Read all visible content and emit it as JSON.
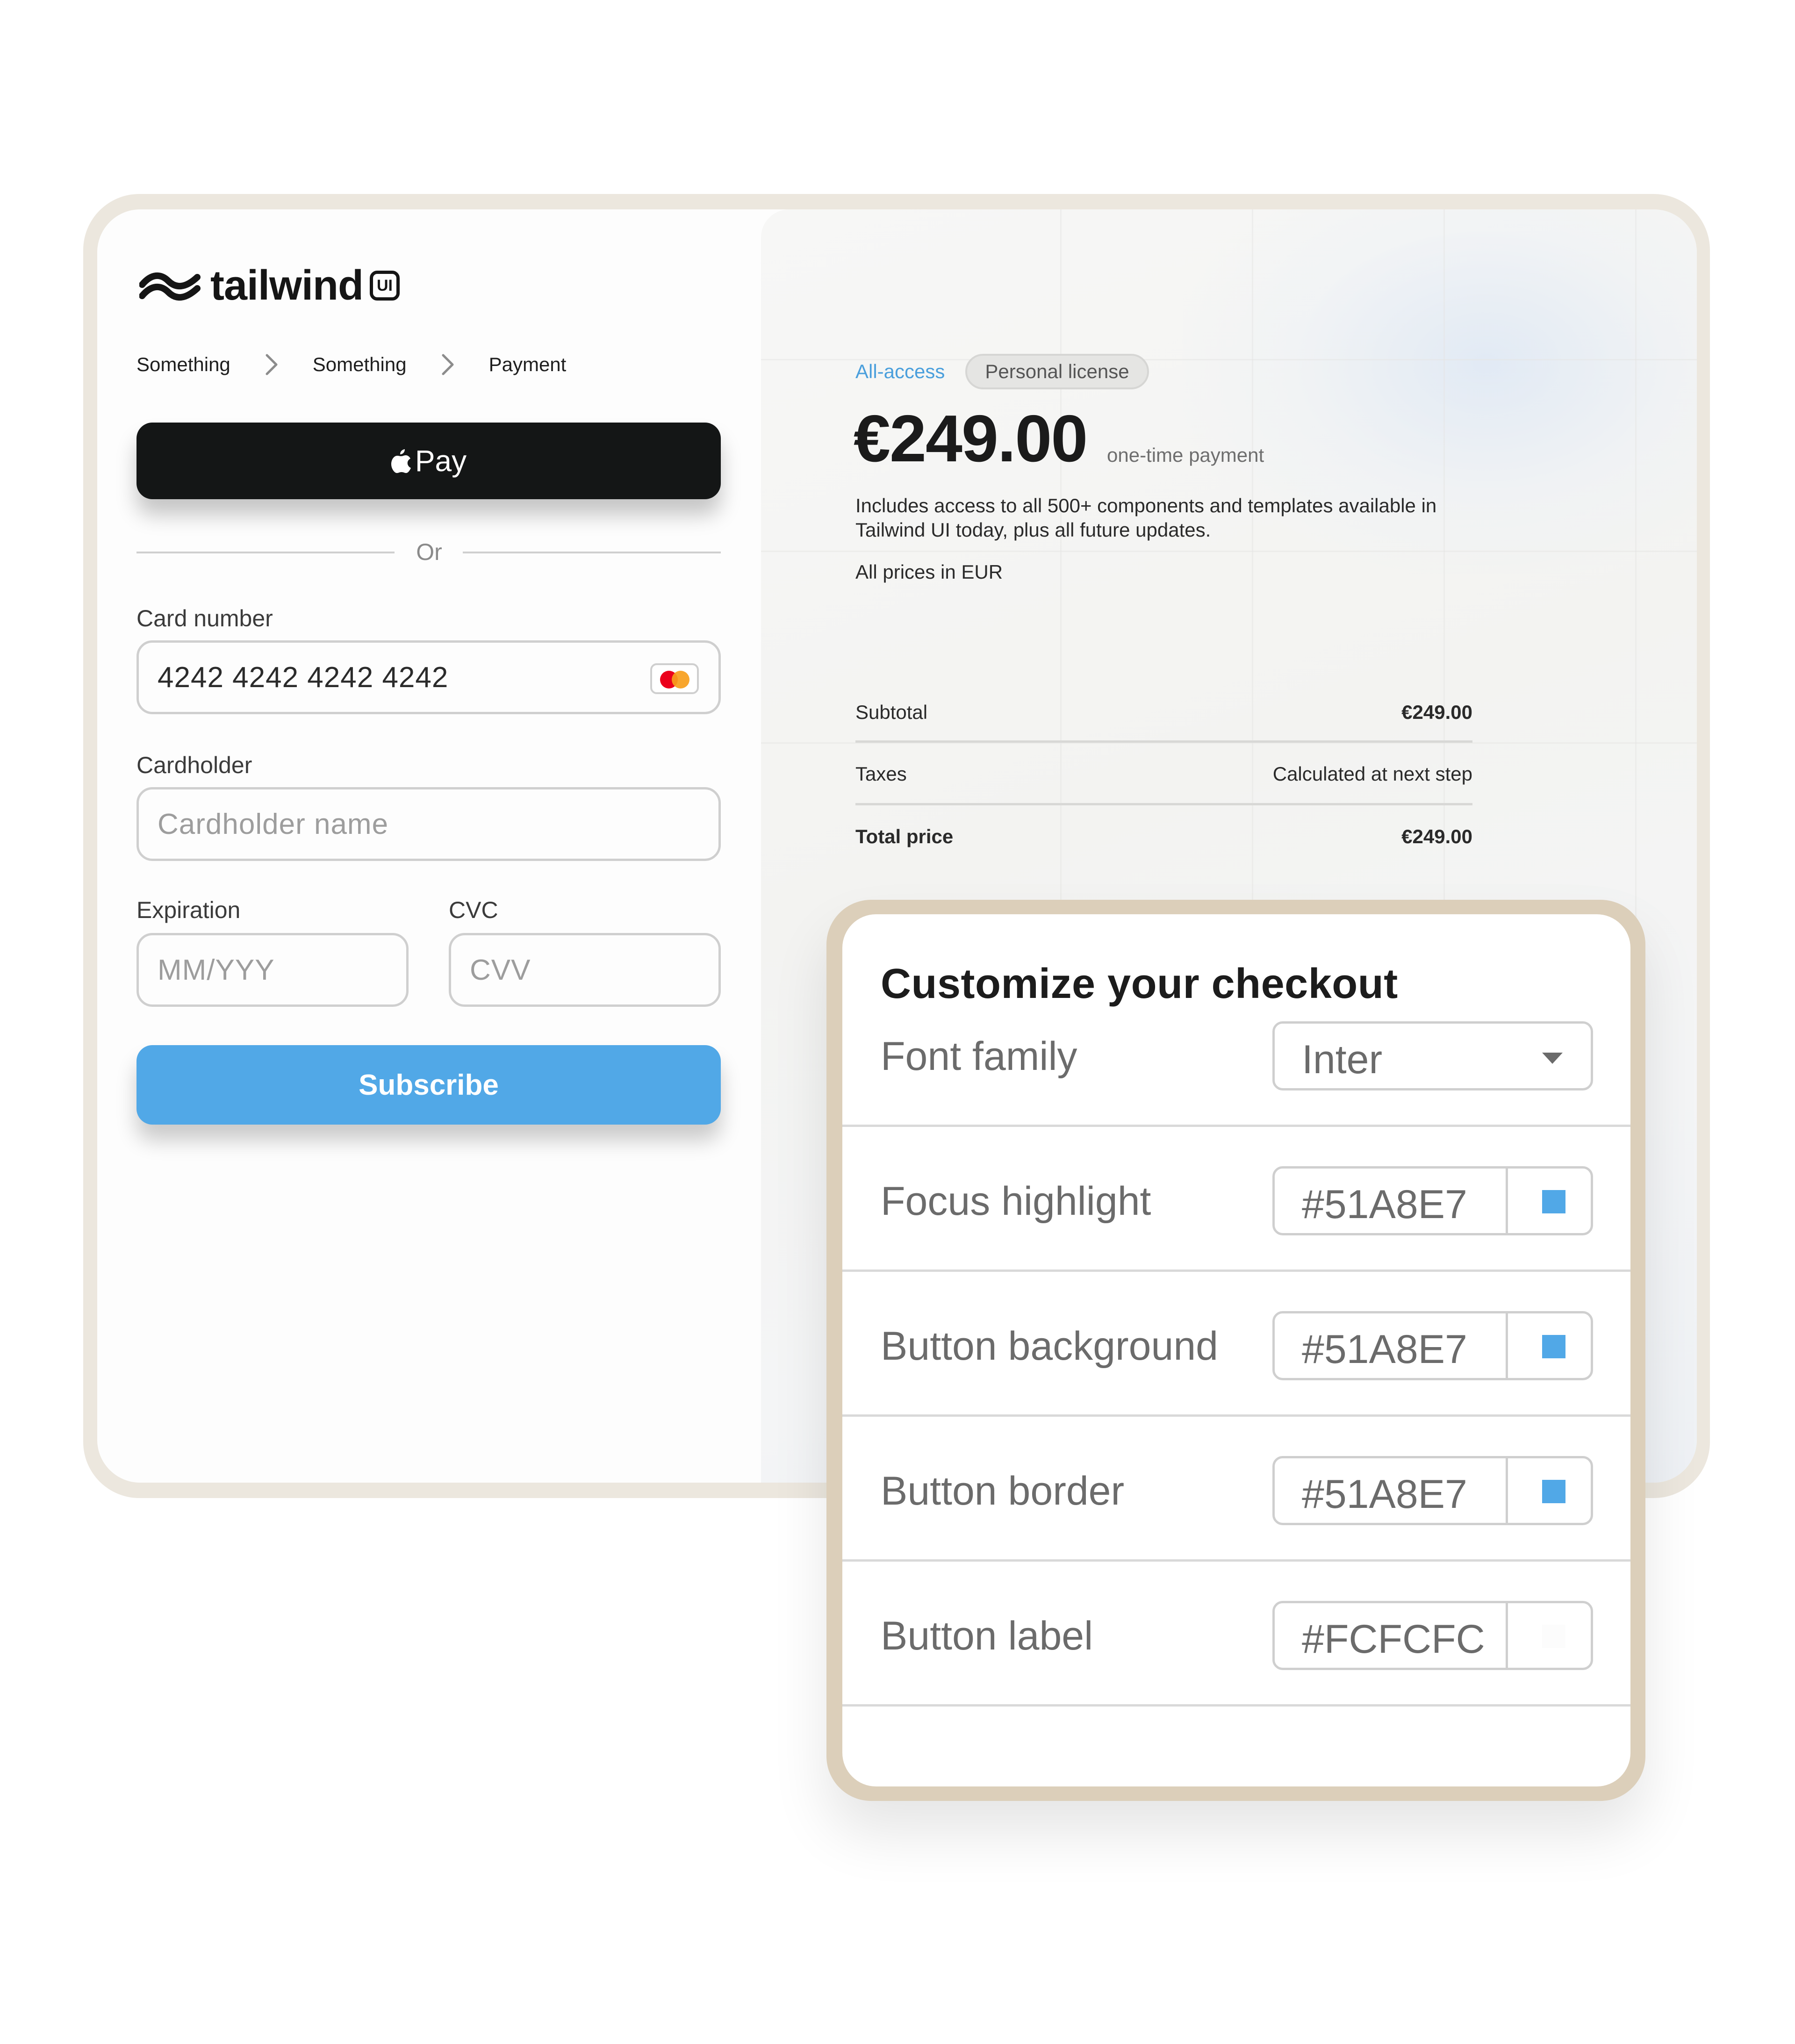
{
  "brand": {
    "name": "tailwind",
    "badge": "UI"
  },
  "breadcrumb": {
    "items": [
      "Something",
      "Something",
      "Payment"
    ]
  },
  "payment": {
    "apple_pay_label": "Pay",
    "divider_text": "Or",
    "card_number": {
      "label": "Card number",
      "value": "4242 4242 4242 4242",
      "brand_icon": "mastercard-icon"
    },
    "cardholder": {
      "label": "Cardholder",
      "placeholder": "Cardholder name"
    },
    "expiration": {
      "label": "Expiration",
      "placeholder": "MM/YYY"
    },
    "cvc": {
      "label": "CVC",
      "placeholder": "CVV"
    },
    "subscribe_label": "Subscribe"
  },
  "plan": {
    "tabs": [
      "All-access",
      "Personal license"
    ],
    "price": "€249.00",
    "price_note": "one-time payment",
    "description": "Includes access to all 500+ components and templates available in Tailwind UI today, plus all future updates.",
    "currency_note": "All prices in EUR"
  },
  "summary": {
    "subtotal": {
      "label": "Subtotal",
      "value": "€249.00"
    },
    "taxes": {
      "label": "Taxes",
      "value": "Calculated at next step"
    },
    "total": {
      "label": "Total price",
      "value": "€249.00"
    }
  },
  "customize": {
    "title": "Customize your checkout",
    "font_family": {
      "label": "Font family",
      "value": "Inter"
    },
    "focus_highlight": {
      "label": "Focus highlight",
      "value": "#51A8E7",
      "color": "#51A8E7"
    },
    "button_background": {
      "label": "Button background",
      "value": "#51A8E7",
      "color": "#51A8E7"
    },
    "button_border": {
      "label": "Button border",
      "value": "#51A8E7",
      "color": "#51A8E7"
    },
    "button_label": {
      "label": "Button label",
      "value": "#FCFCFC",
      "color": "#FCFCFC"
    }
  },
  "colors": {
    "accent": "#51A8E7",
    "apple_pay_bg": "#141616",
    "frame": "#ECE7DE",
    "customize_frame": "#DCCFBA"
  }
}
